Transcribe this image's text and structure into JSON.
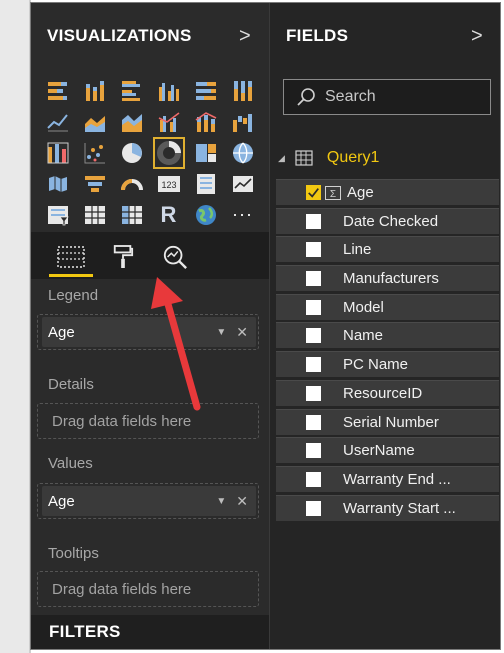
{
  "visualizations": {
    "header": "VISUALIZATIONS",
    "expand_glyph": ">",
    "icons": [
      "stacked-bar-icon",
      "stacked-column-icon",
      "clustered-bar-icon",
      "clustered-column-icon",
      "100-stacked-bar-icon",
      "100-stacked-column-icon",
      "line-chart-icon",
      "area-chart-icon",
      "stacked-area-icon",
      "line-clustered-column-icon",
      "line-stacked-column-icon",
      "waterfall-icon",
      "ribbon-chart-icon",
      "scatter-icon",
      "pie-chart-icon",
      "donut-chart-icon",
      "treemap-icon",
      "globe-map-icon",
      "filled-map-icon",
      "funnel-icon",
      "gauge-icon",
      "card-icon",
      "multi-row-card-icon",
      "kpi-icon",
      "slicer-icon",
      "table-icon",
      "matrix-icon",
      "r-visual-icon",
      "arcgis-map-icon",
      "more-icon"
    ],
    "selected_icon": "donut-chart-icon",
    "r_label": "R",
    "card_label": "123",
    "more_label": "···",
    "tabs": [
      "fields-tab",
      "format-tab",
      "analytics-tab"
    ],
    "active_tab": "fields-tab",
    "sections": {
      "legend": {
        "label": "Legend",
        "field": "Age"
      },
      "details": {
        "label": "Details",
        "placeholder": "Drag data fields here"
      },
      "values": {
        "label": "Values",
        "field": "Age"
      },
      "tooltips": {
        "label": "Tooltips",
        "placeholder": "Drag data fields here"
      }
    },
    "filters_header": "FILTERS",
    "pill_close_glyph": "✕",
    "pill_caret_glyph": "▼"
  },
  "fields": {
    "header": "FIELDS",
    "expand_glyph": ">",
    "search_placeholder": "Search",
    "table_name": "Query1",
    "expander_glyph": "◢",
    "items": [
      {
        "label": "Age",
        "checked": true,
        "sigma": true
      },
      {
        "label": "Date Checked",
        "checked": false
      },
      {
        "label": "Line",
        "checked": false
      },
      {
        "label": "Manufacturers",
        "checked": false
      },
      {
        "label": "Model",
        "checked": false
      },
      {
        "label": "Name",
        "checked": false
      },
      {
        "label": "PC Name",
        "checked": false
      },
      {
        "label": "ResourceID",
        "checked": false
      },
      {
        "label": "Serial Number",
        "checked": false
      },
      {
        "label": "UserName",
        "checked": false
      },
      {
        "label": "Warranty End ...",
        "checked": false
      },
      {
        "label": "Warranty Start ...",
        "checked": false
      }
    ]
  },
  "colors": {
    "accent": "#f2c811",
    "annotation_arrow": "#e8393b",
    "pane_bg": "#2b2b2b"
  }
}
